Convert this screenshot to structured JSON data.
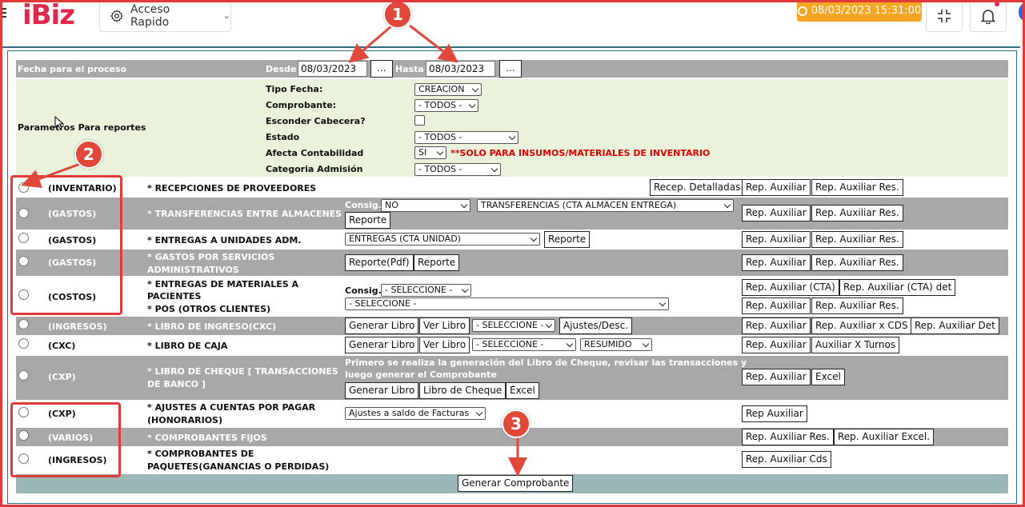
{
  "header": {
    "logo": "iBiz",
    "quick_access": "Acceso Rapido",
    "datetime": "08/03/2023 15:31:00"
  },
  "form": {
    "fecha_label": "Fecha para el proceso",
    "desde_label": "Desde",
    "desde_value": "08/03/2023",
    "hasta_label": "Hasta",
    "hasta_value": "08/03/2023",
    "picker_label": "...",
    "params_label": "Parametros Para reportes",
    "tipo_fecha_label": "Tipo Fecha:",
    "tipo_fecha_value": "CREACION",
    "comprobante_label": "Comprobante:",
    "comprobante_value": "- TODOS -",
    "esconder_label": "Esconder Cabecera?",
    "estado_label": "Estado",
    "estado_value": "- TODOS -",
    "afecta_label": "Afecta Contabilidad",
    "afecta_value": "SI",
    "afecta_note": "**SOLO PARA INSUMOS/MATERIALES DE INVENTARIO",
    "categoria_label": "Categoria Admisión",
    "categoria_value": "- TODOS -"
  },
  "rows": {
    "r1": {
      "type": "(INVENTARIO)",
      "desc": "* RECEPCIONES DE PROVEEDORES",
      "btn1": "Recep. Detalladas",
      "btn2": "Rep. Auxiliar",
      "btn3": "Rep. Auxiliar Res."
    },
    "r2": {
      "type": "(GASTOS)",
      "desc": "* TRANSFERENCIAS ENTRE ALMACENES",
      "consig_label": "Consig.",
      "consig_value": "NO",
      "sel_value": "TRANSFERENCIAS (CTA ALMACEN ENTREGA)",
      "reporte": "Reporte",
      "btn2": "Rep. Auxiliar",
      "btn3": "Rep. Auxiliar Res."
    },
    "r3": {
      "type": "(GASTOS)",
      "desc": "* ENTREGAS A UNIDADES ADM.",
      "sel_value": "ENTREGAS (CTA UNIDAD)",
      "reporte": "Reporte",
      "btn2": "Rep. Auxiliar",
      "btn3": "Rep. Auxiliar Res."
    },
    "r4": {
      "type": "(GASTOS)",
      "desc1": "* GASTOS POR SERVICIOS",
      "desc2": "ADMINISTRATIVOS",
      "pdf": "Reporte(Pdf)",
      "reporte": "Reporte",
      "btn2": "Rep. Auxiliar",
      "btn3": "Rep. Auxiliar Res."
    },
    "r5": {
      "type": "(COSTOS)",
      "desc1": "* ENTREGAS DE MATERIALES A",
      "desc2": "PACIENTES",
      "desc3": "* POS (OTROS CLIENTES)",
      "consig_label": "Consig.",
      "consig_value": "- SELECCIONE -",
      "sel_value": "- SELECCIONE -",
      "btn_cta": "Rep. Auxiliar (CTA)",
      "btn_cta_det": "Rep. Auxiliar (CTA) det",
      "btn2": "Rep. Auxiliar",
      "btn3": "Rep. Auxiliar Res."
    },
    "r6": {
      "type": "(INGRESOS)",
      "desc": "* LIBRO DE INGRESO(CXC)",
      "gen": "Generar Libro",
      "ver": "Ver Libro",
      "sel_value": "- SELECCIONE -",
      "ajustes": "Ajustes/Desc.",
      "btn2": "Rep. Auxiliar",
      "btn3": "Rep. Auxiliar x CDS",
      "btn4": "Rep. Auxiliar Det"
    },
    "r7": {
      "type": "(CXC)",
      "desc": "* LIBRO DE CAJA",
      "gen": "Generar Libro",
      "ver": "Ver Libro",
      "sel_value": "- SELECCIONE -",
      "sel2_value": "RESUMIDO",
      "btn2": "Rep. Auxiliar",
      "btn3": "Auxiliar X Turnos"
    },
    "r8": {
      "type": "(CXP)",
      "desc1": "* LIBRO DE CHEQUE [ TRANSACCIONES",
      "desc2": "DE BANCO ]",
      "note1": "Primero se realiza la generación del Libro de Cheque, revisar las transacciones y",
      "note2": "luego generar el Comprobante",
      "gen": "Generar Libro",
      "cheque": "Libro de Cheque",
      "excel": "Excel",
      "btn2": "Rep. Auxiliar",
      "btn3": "Excel"
    },
    "r9": {
      "type": "(CXP)",
      "desc1": "* AJUSTES A CUENTAS POR PAGAR",
      "desc2": "(HONORARIOS)",
      "sel_value": "Ajustes a saldo de Facturas",
      "btn2": "Rep Auxiliar"
    },
    "r10": {
      "type": "(VARIOS)",
      "desc": "* COMPROBANTES FIJOS",
      "btn2": "Rep. Auxiliar Res.",
      "btn3": "Rep. Auxiliar Excel."
    },
    "r11": {
      "type": "(INGRESOS)",
      "desc1": "* COMPROBANTES DE",
      "desc2": "PAQUETES(GANANCIAS O PERDIDAS)",
      "btn2": "Rep. Auxiliar Cds"
    }
  },
  "generate_button": "Generar Comprobante",
  "annotations": {
    "b1": "1",
    "b2": "2",
    "b3": "3"
  },
  "colors": {
    "accent_red": "#e03a3a",
    "gray_row": "#a8a8a8",
    "green_panel": "#eaf2dc",
    "footer_teal": "#9ab6b7",
    "datetime_bg": "#f5a623"
  }
}
